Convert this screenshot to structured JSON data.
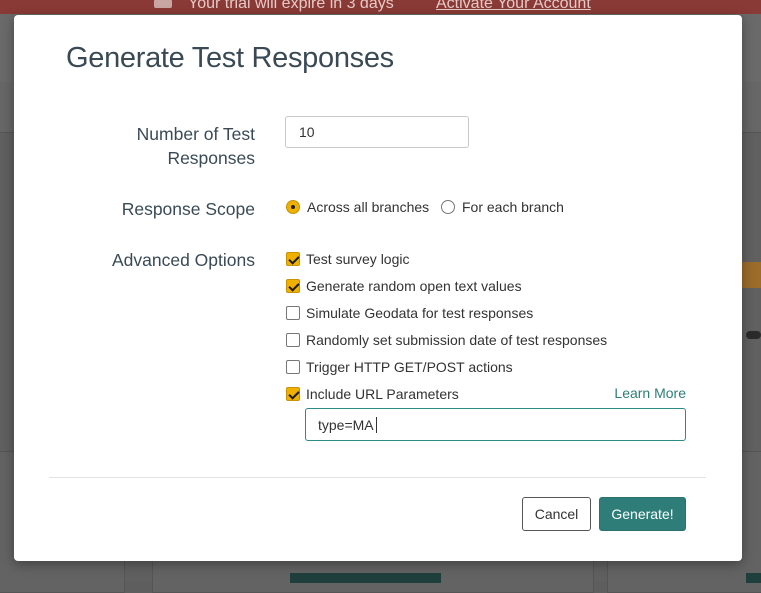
{
  "background": {
    "banner_text": "Your trial will expire in 3 days",
    "banner_link": "Activate Your Account"
  },
  "modal": {
    "title": "Generate Test Responses",
    "number_label": "Number of Test Responses",
    "number_value": "10",
    "scope_label": "Response Scope",
    "scope_options": [
      {
        "label": "Across all branches",
        "selected": true
      },
      {
        "label": "For each branch",
        "selected": false
      }
    ],
    "advanced_label": "Advanced Options",
    "advanced_options": [
      {
        "label": "Test survey logic",
        "checked": true
      },
      {
        "label": "Generate random open text values",
        "checked": true
      },
      {
        "label": "Simulate Geodata for test responses",
        "checked": false
      },
      {
        "label": "Randomly set submission date of test responses",
        "checked": false
      },
      {
        "label": "Trigger HTTP GET/POST actions",
        "checked": false
      },
      {
        "label": "Include URL Parameters",
        "checked": true
      }
    ],
    "learn_more": "Learn More",
    "url_params_value": "type=MA",
    "cancel_label": "Cancel",
    "generate_label": "Generate!"
  },
  "colors": {
    "accent": "#2e7d78",
    "check": "#f0b000"
  }
}
